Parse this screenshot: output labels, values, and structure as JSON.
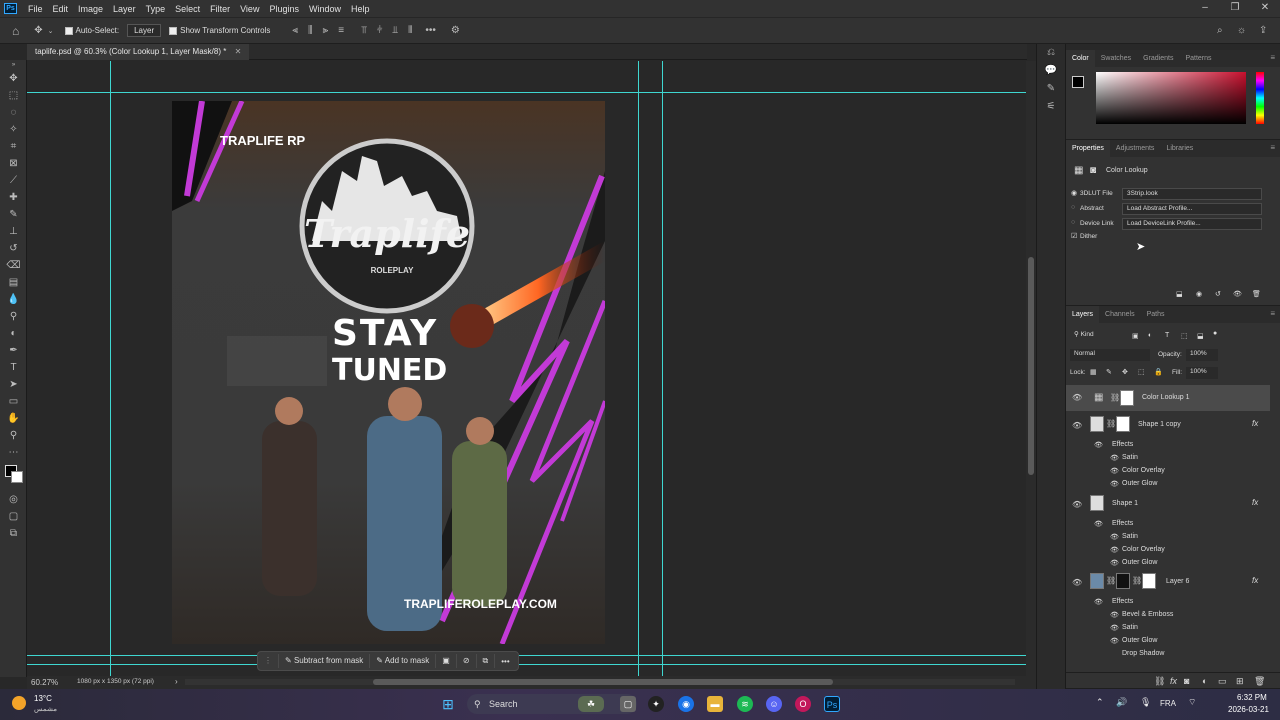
{
  "menu": [
    "File",
    "Edit",
    "Image",
    "Layer",
    "Type",
    "Select",
    "Filter",
    "View",
    "Plugins",
    "Window",
    "Help"
  ],
  "options": {
    "auto_select": "Auto-Select:",
    "layer_select": "Layer",
    "show_transform": "Show Transform Controls"
  },
  "doc_tab": "taplife.psd @ 60.3% (Color Lookup 1, Layer Mask/8) *",
  "status": {
    "zoom": "60.27%",
    "size": "1080 px x 1350 px (72 ppi)"
  },
  "mask_bar": {
    "subtract": "Subtract from mask",
    "add": "Add to mask"
  },
  "poster": {
    "top_label": "TRAPLIFE RP",
    "logo_main": "Traplife",
    "logo_sub": "ROLEPLAY",
    "headline1": "STAY",
    "headline2": "TUNED",
    "url": "TRAPLIFEROLEPLAY.COM"
  },
  "color_panel": {
    "tabs": [
      "Color",
      "Swatches",
      "Gradients",
      "Patterns"
    ]
  },
  "properties": {
    "tabs": [
      "Properties",
      "Adjustments",
      "Libraries"
    ],
    "title": "Color Lookup",
    "rows": [
      {
        "label": "3DLUT File",
        "value": "3Strip.look"
      },
      {
        "label": "Abstract",
        "value": "Load Abstract Profile..."
      },
      {
        "label": "Device Link",
        "value": "Load DeviceLink Profile..."
      }
    ],
    "dither": "Dither"
  },
  "layers_panel": {
    "tabs": [
      "Layers",
      "Channels",
      "Paths"
    ],
    "kind": "Kind",
    "blend": "Normal",
    "opacity_label": "Opacity:",
    "opacity": "100%",
    "lock_label": "Lock:",
    "fill_label": "Fill:",
    "fill": "100%",
    "layers": [
      {
        "name": "Color Lookup 1",
        "effects": []
      },
      {
        "name": "Shape 1 copy",
        "effects": [
          "Satin",
          "Color Overlay",
          "Outer Glow"
        ]
      },
      {
        "name": "Shape 1",
        "effects": [
          "Satin",
          "Color Overlay",
          "Outer Glow"
        ]
      },
      {
        "name": "Layer 6",
        "effects": [
          "Bevel & Emboss",
          "Satin",
          "Outer Glow",
          "Drop Shadow"
        ]
      }
    ],
    "effects_label": "Effects"
  },
  "taskbar": {
    "weather_temp": "13°C",
    "weather_desc": "مشمس",
    "search": "Search",
    "lang": "FRA",
    "time": "6:32 PM",
    "date": "2026-03-21"
  },
  "colors": {
    "guide": "#3fd7d1",
    "accent_magenta": "#c23ad6"
  }
}
